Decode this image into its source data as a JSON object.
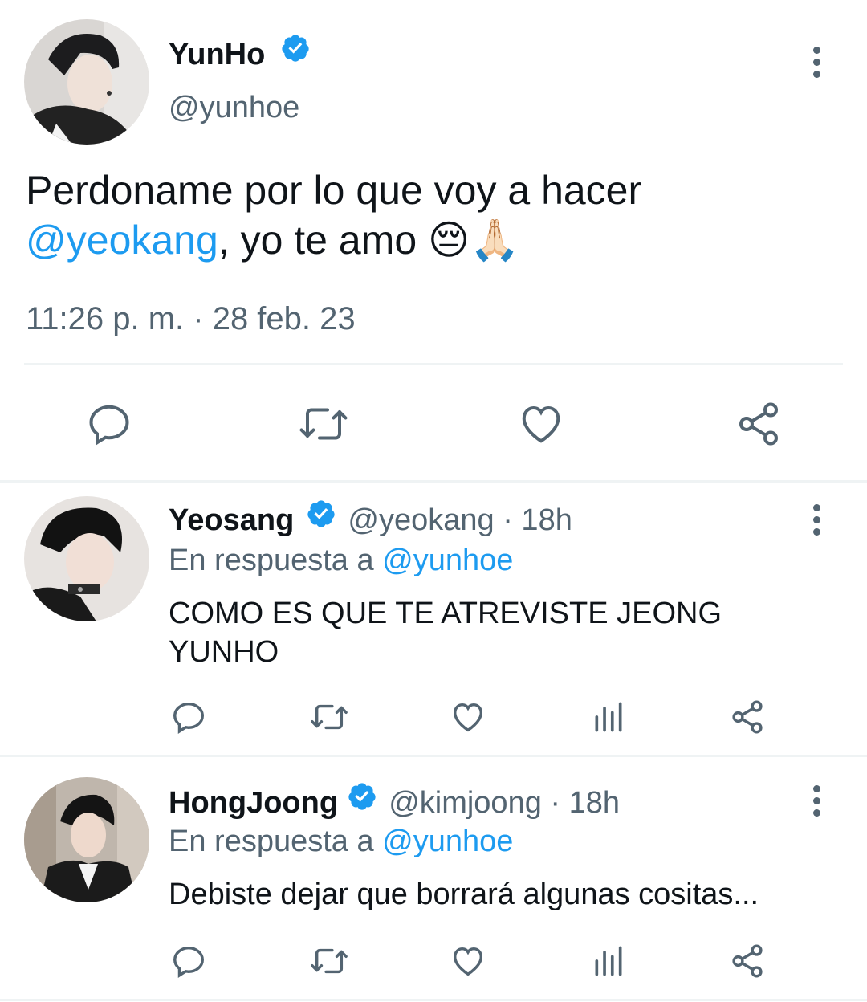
{
  "main_tweet": {
    "display_name": "YunHo",
    "handle": "@yunhoe",
    "text_part1": "Perdoname por lo que voy a hacer",
    "mention": "@yeokang",
    "text_part2": ", yo te amo",
    "emoji": "😔🙏🏻",
    "timestamp": "11:26 p. m. · 28 feb. 23",
    "actions": [
      "reply-icon",
      "retweet-icon",
      "like-icon",
      "share-icon"
    ]
  },
  "replies": [
    {
      "display_name": "Yeosang",
      "handle_time": "@yeokang · 18h",
      "replying_prefix": "En respuesta a ",
      "replying_to": "@yunhoe",
      "text": "COMO ES QUE TE ATREVISTE JEONG YUNHO",
      "actions": [
        "reply-icon",
        "retweet-icon",
        "like-icon",
        "analytics-icon",
        "share-icon"
      ]
    },
    {
      "display_name": "HongJoong",
      "handle_time": "@kimjoong · 18h",
      "replying_prefix": "En respuesta a ",
      "replying_to": "@yunhoe",
      "text": "Debiste dejar que borrará algunas cositas...",
      "actions": [
        "reply-icon",
        "retweet-icon",
        "like-icon",
        "analytics-icon",
        "share-icon"
      ]
    }
  ],
  "colors": {
    "accent": "#1d9bf0",
    "secondary_text": "#536471",
    "icon": "#536471",
    "divider": "#eff3f4"
  }
}
